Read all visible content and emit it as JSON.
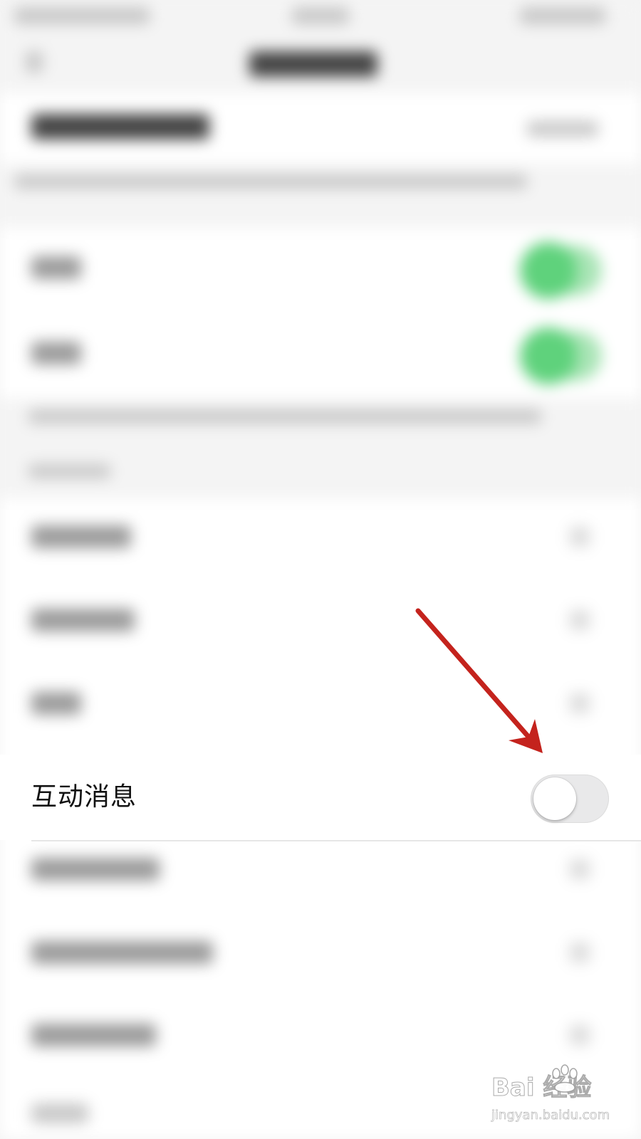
{
  "settings": {
    "focused_item": {
      "label": "互动消息",
      "toggle_on": false
    }
  },
  "annotation": {
    "arrow_color": "#c4231d"
  },
  "watermark": {
    "brand": "Bai 经验",
    "url": "jingyan.baidu.com"
  },
  "colors": {
    "toggle_on": "#5fd27c",
    "toggle_off_track": "#e9e9ea",
    "background": "#f4f4f4"
  }
}
